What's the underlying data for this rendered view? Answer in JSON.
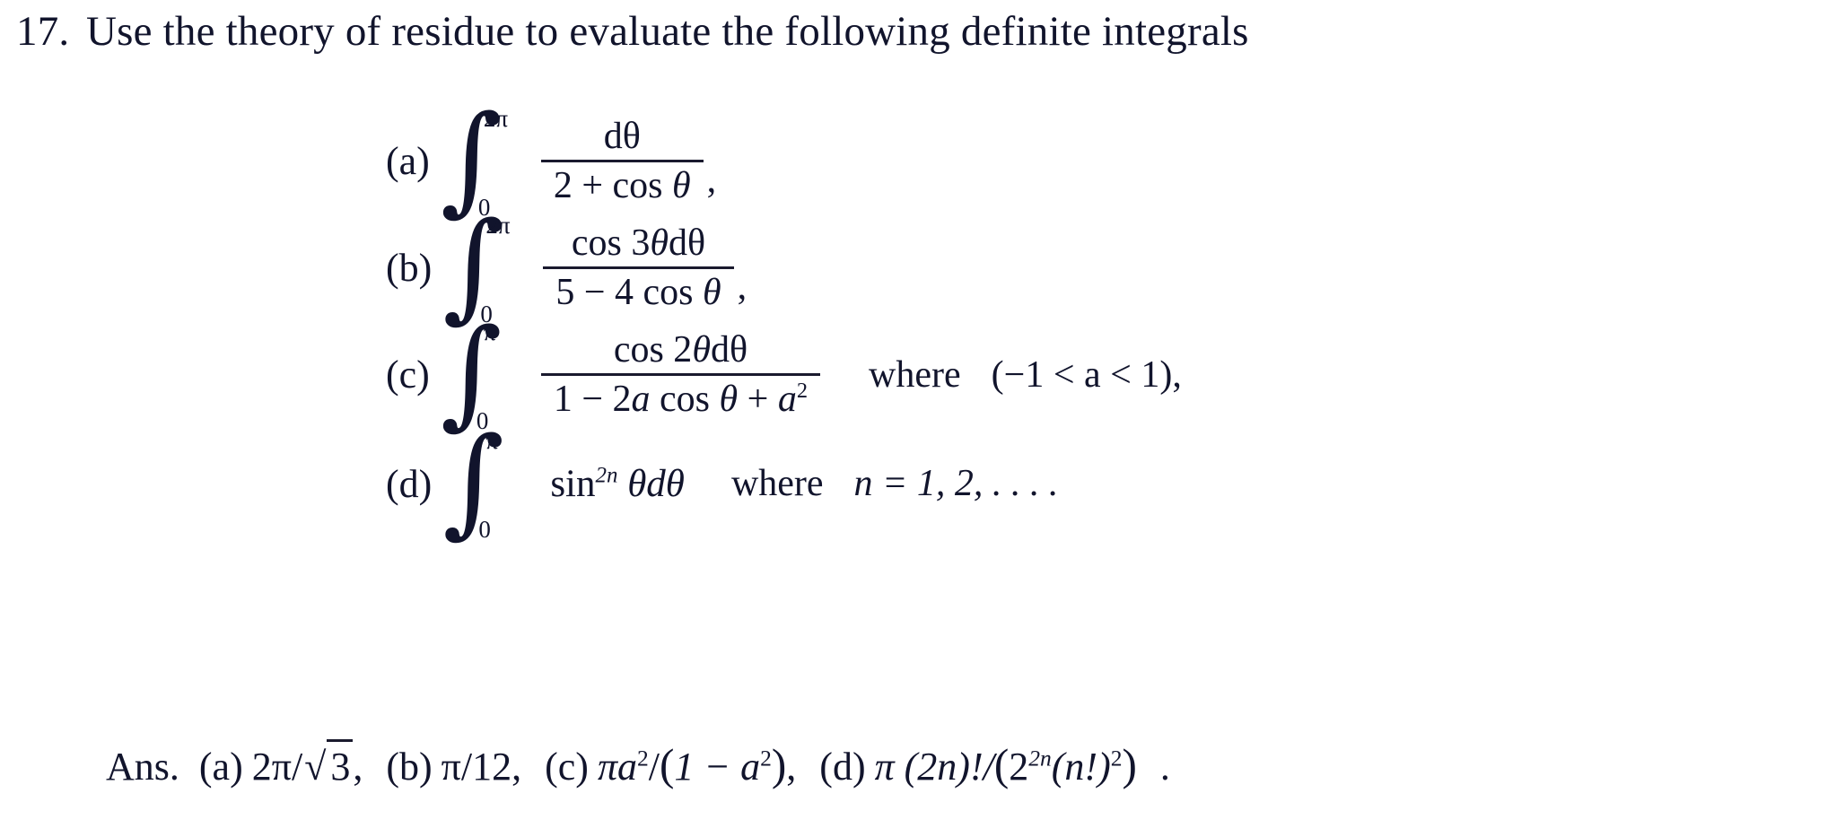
{
  "problem": {
    "number": "17.",
    "statement": "Use the theory of residue to evaluate the following definite integrals"
  },
  "items": [
    {
      "label": "(a)",
      "integral": {
        "lower": "0",
        "upper": "2π"
      },
      "numerator": "dθ",
      "denominator_pre": "2 + cos ",
      "denominator_var": "θ",
      "trailing": ",",
      "where": "",
      "condition": ""
    },
    {
      "label": "(b)",
      "integral": {
        "lower": "0",
        "upper": "2π"
      },
      "numerator_pre": "cos 3",
      "numerator_var": "θ",
      "numerator_post": "dθ",
      "denominator_pre": "5 − 4 cos ",
      "denominator_var": "θ",
      "trailing": ",",
      "where": "",
      "condition": ""
    },
    {
      "label": "(c)",
      "integral": {
        "lower": "0",
        "upper": "π"
      },
      "numerator_pre": "cos 2",
      "numerator_var": "θ",
      "numerator_post": "dθ",
      "denominator_pre": "1 − 2",
      "denominator_a": "a",
      "denominator_mid": " cos ",
      "denominator_var": "θ",
      "denominator_plus": " + ",
      "denominator_a2": "a",
      "denominator_exp": "2",
      "trailing": "",
      "where": "where",
      "condition": "(−1 < a < 1),"
    },
    {
      "label": "(d)",
      "integral": {
        "lower": "0",
        "upper": "π"
      },
      "expression_fn": "sin",
      "expression_exp": "2n",
      "expression_rest": "θdθ",
      "where": "where",
      "condition": "n = 1, 2, . . . ."
    }
  ],
  "answer": {
    "label": "Ans.",
    "part_a_label": "(a)",
    "part_a_value_pre": "2π/",
    "part_a_sqrt": "3",
    "part_a_comma": ",",
    "part_b_label": "(b)",
    "part_b_value": "π/12,",
    "part_c_label": "(c)",
    "part_c_pre": "πa",
    "part_c_exp": "2",
    "part_c_slash": "/",
    "part_c_paren_open": "(",
    "part_c_inner_pre": "1 − a",
    "part_c_inner_exp": "2",
    "part_c_paren_close": ")",
    "part_c_comma": ",",
    "part_d_label": "(d)",
    "part_d_pre": "π (2n)!/",
    "part_d_paren_open": "(",
    "part_d_base": "2",
    "part_d_exp": "2n",
    "part_d_inner": "(n!)",
    "part_d_inner_exp": "2",
    "part_d_paren_close": ")",
    "part_d_period": "."
  },
  "colors": {
    "ink": "#11142c",
    "background": "#ffffff",
    "rule": "#1a1a2e"
  }
}
